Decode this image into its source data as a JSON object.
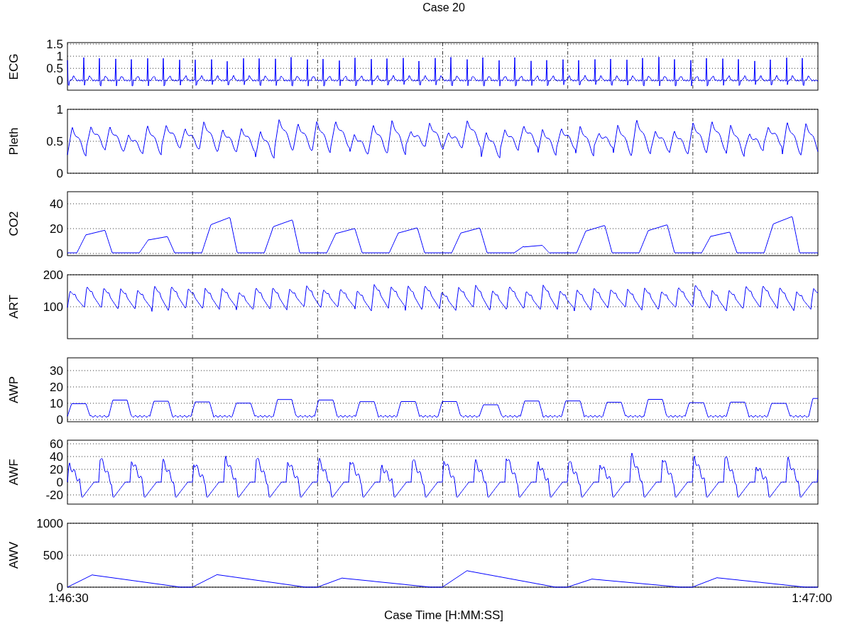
{
  "title": "Case 20",
  "panels": [
    {
      "kind": "ecg",
      "label": "ECG",
      "yticks": [
        "1.5",
        "1",
        "0.5",
        "0"
      ]
    },
    {
      "kind": "pleth",
      "label": "Pleth",
      "yticks": [
        "1",
        "0.5",
        "0"
      ]
    },
    {
      "kind": "co2",
      "label": "CO2",
      "yticks": [
        "40",
        "20",
        "0"
      ]
    },
    {
      "kind": "art",
      "label": "ART",
      "yticks": [
        "200",
        "100"
      ]
    },
    {
      "kind": "awp",
      "label": "AWP",
      "yticks": [
        "30",
        "20",
        "10",
        "0"
      ]
    },
    {
      "kind": "awf",
      "label": "AWF",
      "yticks": [
        "60",
        "40",
        "20",
        "0",
        "-20"
      ]
    },
    {
      "kind": "awv",
      "label": "AWV",
      "yticks": [
        "1000",
        "500",
        "0"
      ]
    }
  ],
  "x_axis": {
    "ticks": [
      "1:46:30",
      "1:47:00"
    ],
    "label": "Case Time [H:MM:SS]"
  }
}
